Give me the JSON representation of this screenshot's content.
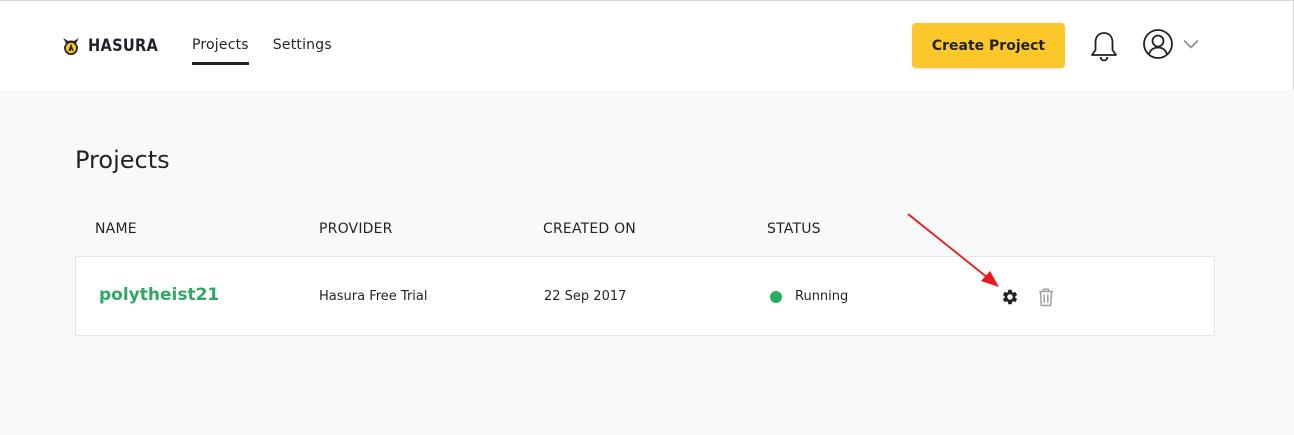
{
  "header": {
    "logo_text": "HASURA",
    "nav": [
      {
        "label": "Projects",
        "active": true
      },
      {
        "label": "Settings",
        "active": false
      }
    ],
    "create_button_label": "Create Project",
    "icons": [
      "bell-icon",
      "user-avatar-icon",
      "chevron-down-icon"
    ]
  },
  "main": {
    "title": "Projects",
    "table": {
      "columns": [
        "NAME",
        "PROVIDER",
        "CREATED ON",
        "STATUS"
      ],
      "rows": [
        {
          "name": "polytheist21",
          "provider": "Hasura Free Trial",
          "created_on": "22 Sep 2017",
          "status": "Running",
          "actions": [
            "gear-icon",
            "trash-icon"
          ]
        }
      ]
    }
  },
  "colors": {
    "accent": "#fcc72a",
    "project_name": "#2fa866",
    "status_running": "#27ae60",
    "annotation_arrow": "#e8191b"
  }
}
